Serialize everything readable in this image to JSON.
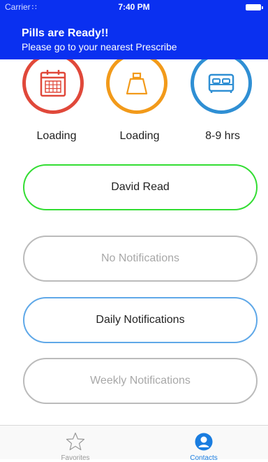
{
  "status_bar": {
    "carrier": "Carrier",
    "time": "7:40 PM"
  },
  "notification": {
    "title": "Pills are Ready!!",
    "message": "Please go to your nearest Prescribe"
  },
  "stats": [
    {
      "label": "Loading",
      "icon": "calendar-icon",
      "color": "#e0483a"
    },
    {
      "label": "Loading",
      "icon": "weight-icon",
      "color": "#f29a1a"
    },
    {
      "label": "8-9 hrs",
      "icon": "bed-icon",
      "color": "#2f8fd4"
    }
  ],
  "user_button": {
    "label": "David Read",
    "border_color": "#33dd33"
  },
  "notification_options": [
    {
      "label": "No Notifications",
      "selected": false
    },
    {
      "label": "Daily Notifications",
      "selected": true
    },
    {
      "label": "Weekly Notifications",
      "selected": false
    }
  ],
  "colors": {
    "banner": "#0a30f0",
    "selected_border": "#5fa8e8",
    "unselected_border": "#bbbbbb",
    "unselected_text": "#a8a8a8",
    "tab_active": "#1a7de0",
    "tab_inactive": "#9a9a9a"
  },
  "tab_bar": {
    "tabs": [
      {
        "label": "Favorites",
        "icon": "star-icon",
        "active": false
      },
      {
        "label": "Contacts",
        "icon": "contacts-icon",
        "active": true
      }
    ]
  }
}
